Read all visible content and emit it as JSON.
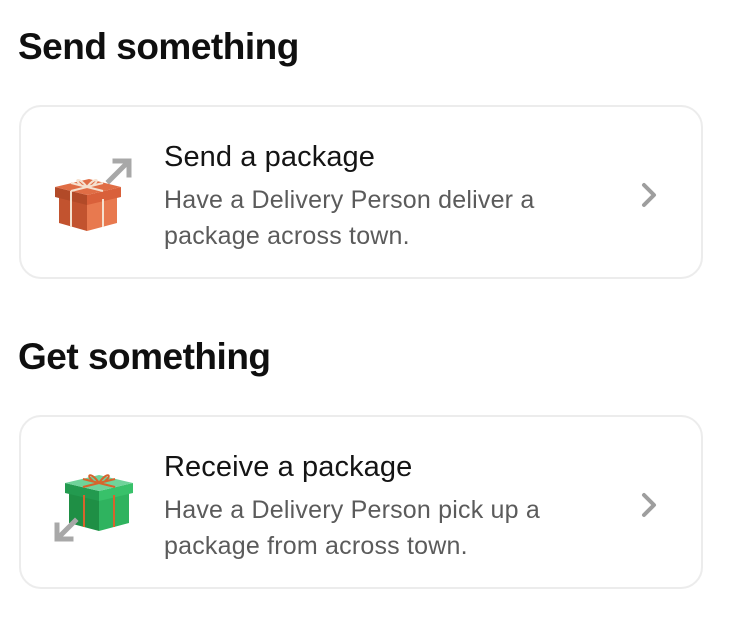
{
  "send_section": {
    "title": "Send something",
    "card": {
      "title": "Send a package",
      "description": "Have a Delivery Person deliver a package across town.",
      "icon": "gift-box-outgoing-icon",
      "icon_color": "#d9603a"
    }
  },
  "get_section": {
    "title": "Get something",
    "card": {
      "title": "Receive a package",
      "description": "Have a Delivery Person pick up a package from across town.",
      "icon": "gift-box-incoming-icon",
      "icon_color": "#2fb35f"
    }
  },
  "colors": {
    "chevron": "#9e9e9e",
    "card_border": "#ececec",
    "description_text": "#5b5b5b"
  }
}
